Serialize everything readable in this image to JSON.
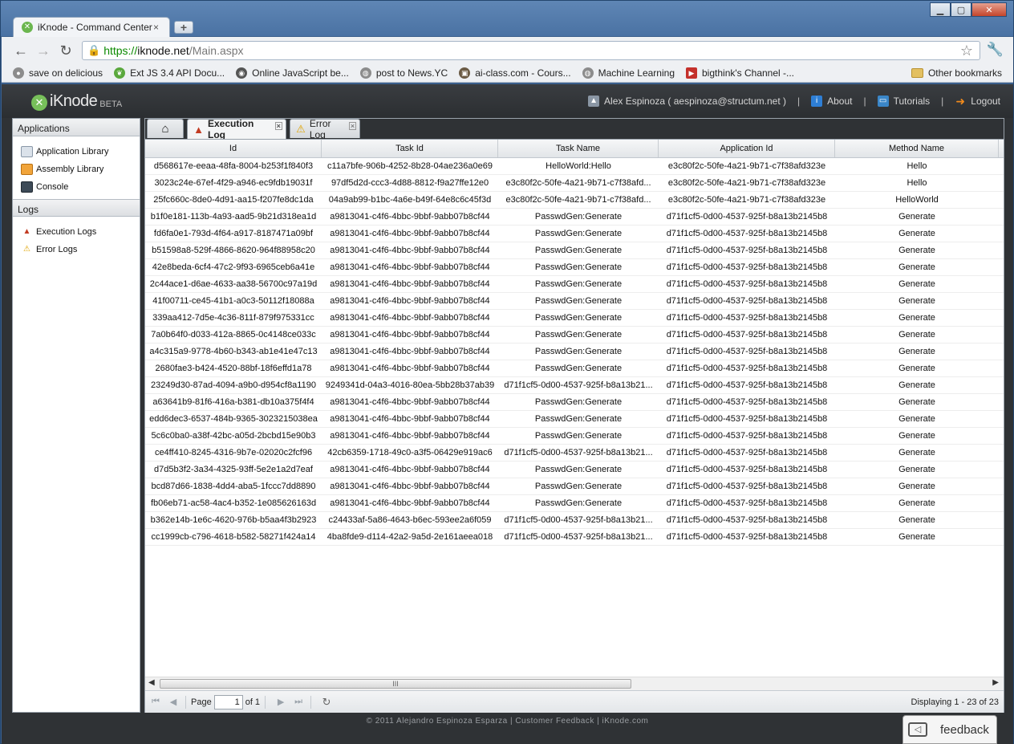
{
  "browser": {
    "tab_title": "iKnode - Command Center",
    "url_scheme": "https://",
    "url_host": "iknode.net",
    "url_path": "/Main.aspx",
    "bookmarks": [
      {
        "label": "save on delicious",
        "icon": "delicious-icon"
      },
      {
        "label": "Ext JS 3.4 API Docu...",
        "icon": "leaf-icon"
      },
      {
        "label": "Online JavaScript be...",
        "icon": "owl-icon"
      },
      {
        "label": "post to News.YC",
        "icon": "globe-icon"
      },
      {
        "label": "ai-class.com - Cours...",
        "icon": "robot-icon"
      },
      {
        "label": "Machine Learning",
        "icon": "globe-icon"
      },
      {
        "label": "bigthink's Channel -...",
        "icon": "youtube-icon"
      }
    ],
    "other_bookmarks": "Other bookmarks"
  },
  "header": {
    "logo_name": "iKnode",
    "logo_beta": "BETA",
    "user": "Alex Espinoza ( aespinoza@structum.net )",
    "sep": "|",
    "about": "About",
    "tutorials": "Tutorials",
    "logout": "Logout"
  },
  "sidebar": {
    "applications_title": "Applications",
    "applications_items": [
      "Application Library",
      "Assembly Library",
      "Console"
    ],
    "logs_title": "Logs",
    "logs_items": [
      "Execution Logs",
      "Error Logs"
    ]
  },
  "tabs": {
    "execution": "Execution Log",
    "error": "Error Log"
  },
  "grid": {
    "columns": [
      "Id",
      "Task Id",
      "Task Name",
      "Application Id",
      "Method Name"
    ],
    "rows": [
      [
        "d568617e-eeaa-48fa-8004-b253f1f840f3",
        "c11a7bfe-906b-4252-8b28-04ae236a0e69",
        "HelloWorld:Hello",
        "e3c80f2c-50fe-4a21-9b71-c7f38afd323e",
        "Hello"
      ],
      [
        "3023c24e-67ef-4f29-a946-ec9fdb19031f",
        "97df5d2d-ccc3-4d88-8812-f9a27ffe12e0",
        "e3c80f2c-50fe-4a21-9b71-c7f38afd...",
        "e3c80f2c-50fe-4a21-9b71-c7f38afd323e",
        "Hello"
      ],
      [
        "25fc660c-8de0-4d91-aa15-f207fe8dc1da",
        "04a9ab99-b1bc-4a6e-b49f-64e8c6c45f3d",
        "e3c80f2c-50fe-4a21-9b71-c7f38afd...",
        "e3c80f2c-50fe-4a21-9b71-c7f38afd323e",
        "HelloWorld"
      ],
      [
        "b1f0e181-113b-4a93-aad5-9b21d318ea1d",
        "a9813041-c4f6-4bbc-9bbf-9abb07b8cf44",
        "PasswdGen:Generate",
        "d71f1cf5-0d00-4537-925f-b8a13b2145b8",
        "Generate"
      ],
      [
        "fd6fa0e1-793d-4f64-a917-8187471a09bf",
        "a9813041-c4f6-4bbc-9bbf-9abb07b8cf44",
        "PasswdGen:Generate",
        "d71f1cf5-0d00-4537-925f-b8a13b2145b8",
        "Generate"
      ],
      [
        "b51598a8-529f-4866-8620-964f88958c20",
        "a9813041-c4f6-4bbc-9bbf-9abb07b8cf44",
        "PasswdGen:Generate",
        "d71f1cf5-0d00-4537-925f-b8a13b2145b8",
        "Generate"
      ],
      [
        "42e8beda-6cf4-47c2-9f93-6965ceb6a41e",
        "a9813041-c4f6-4bbc-9bbf-9abb07b8cf44",
        "PasswdGen:Generate",
        "d71f1cf5-0d00-4537-925f-b8a13b2145b8",
        "Generate"
      ],
      [
        "2c44ace1-d6ae-4633-aa38-56700c97a19d",
        "a9813041-c4f6-4bbc-9bbf-9abb07b8cf44",
        "PasswdGen:Generate",
        "d71f1cf5-0d00-4537-925f-b8a13b2145b8",
        "Generate"
      ],
      [
        "41f00711-ce45-41b1-a0c3-50112f18088a",
        "a9813041-c4f6-4bbc-9bbf-9abb07b8cf44",
        "PasswdGen:Generate",
        "d71f1cf5-0d00-4537-925f-b8a13b2145b8",
        "Generate"
      ],
      [
        "339aa412-7d5e-4c36-811f-879f975331cc",
        "a9813041-c4f6-4bbc-9bbf-9abb07b8cf44",
        "PasswdGen:Generate",
        "d71f1cf5-0d00-4537-925f-b8a13b2145b8",
        "Generate"
      ],
      [
        "7a0b64f0-d033-412a-8865-0c4148ce033c",
        "a9813041-c4f6-4bbc-9bbf-9abb07b8cf44",
        "PasswdGen:Generate",
        "d71f1cf5-0d00-4537-925f-b8a13b2145b8",
        "Generate"
      ],
      [
        "a4c315a9-9778-4b60-b343-ab1e41e47c13",
        "a9813041-c4f6-4bbc-9bbf-9abb07b8cf44",
        "PasswdGen:Generate",
        "d71f1cf5-0d00-4537-925f-b8a13b2145b8",
        "Generate"
      ],
      [
        "2680fae3-b424-4520-88bf-18f6effd1a78",
        "a9813041-c4f6-4bbc-9bbf-9abb07b8cf44",
        "PasswdGen:Generate",
        "d71f1cf5-0d00-4537-925f-b8a13b2145b8",
        "Generate"
      ],
      [
        "23249d30-87ad-4094-a9b0-d954cf8a1190",
        "9249341d-04a3-4016-80ea-5bb28b37ab39",
        "d71f1cf5-0d00-4537-925f-b8a13b21...",
        "d71f1cf5-0d00-4537-925f-b8a13b2145b8",
        "Generate"
      ],
      [
        "a63641b9-81f6-416a-b381-db10a375f4f4",
        "a9813041-c4f6-4bbc-9bbf-9abb07b8cf44",
        "PasswdGen:Generate",
        "d71f1cf5-0d00-4537-925f-b8a13b2145b8",
        "Generate"
      ],
      [
        "edd6dec3-6537-484b-9365-3023215038ea",
        "a9813041-c4f6-4bbc-9bbf-9abb07b8cf44",
        "PasswdGen:Generate",
        "d71f1cf5-0d00-4537-925f-b8a13b2145b8",
        "Generate"
      ],
      [
        "5c6c0ba0-a38f-42bc-a05d-2bcbd15e90b3",
        "a9813041-c4f6-4bbc-9bbf-9abb07b8cf44",
        "PasswdGen:Generate",
        "d71f1cf5-0d00-4537-925f-b8a13b2145b8",
        "Generate"
      ],
      [
        "ce4ff410-8245-4316-9b7e-02020c2fcf96",
        "42cb6359-1718-49c0-a3f5-06429e919ac6",
        "d71f1cf5-0d00-4537-925f-b8a13b21...",
        "d71f1cf5-0d00-4537-925f-b8a13b2145b8",
        "Generate"
      ],
      [
        "d7d5b3f2-3a34-4325-93ff-5e2e1a2d7eaf",
        "a9813041-c4f6-4bbc-9bbf-9abb07b8cf44",
        "PasswdGen:Generate",
        "d71f1cf5-0d00-4537-925f-b8a13b2145b8",
        "Generate"
      ],
      [
        "bcd87d66-1838-4dd4-aba5-1fccc7dd8890",
        "a9813041-c4f6-4bbc-9bbf-9abb07b8cf44",
        "PasswdGen:Generate",
        "d71f1cf5-0d00-4537-925f-b8a13b2145b8",
        "Generate"
      ],
      [
        "fb06eb71-ac58-4ac4-b352-1e085626163d",
        "a9813041-c4f6-4bbc-9bbf-9abb07b8cf44",
        "PasswdGen:Generate",
        "d71f1cf5-0d00-4537-925f-b8a13b2145b8",
        "Generate"
      ],
      [
        "b362e14b-1e6c-4620-976b-b5aa4f3b2923",
        "c24433af-5a86-4643-b6ec-593ee2a6f059",
        "d71f1cf5-0d00-4537-925f-b8a13b21...",
        "d71f1cf5-0d00-4537-925f-b8a13b2145b8",
        "Generate"
      ],
      [
        "cc1999cb-c796-4618-b582-58271f424a14",
        "4ba8fde9-d114-42a2-9a5d-2e161aeea018",
        "d71f1cf5-0d00-4537-925f-b8a13b21...",
        "d71f1cf5-0d00-4537-925f-b8a13b2145b8",
        "Generate"
      ]
    ]
  },
  "pager": {
    "page_label": "Page",
    "page_value": "1",
    "of_label": "of 1",
    "display_info": "Displaying 1 - 23 of 23",
    "scroll_grip": "III"
  },
  "footer": {
    "copyright": "© 2011 Alejandro Espinoza Esparza",
    "sep": "|",
    "customer_feedback": "Customer Feedback",
    "site": "iKnode.com"
  },
  "feedback": {
    "label": "feedback"
  }
}
